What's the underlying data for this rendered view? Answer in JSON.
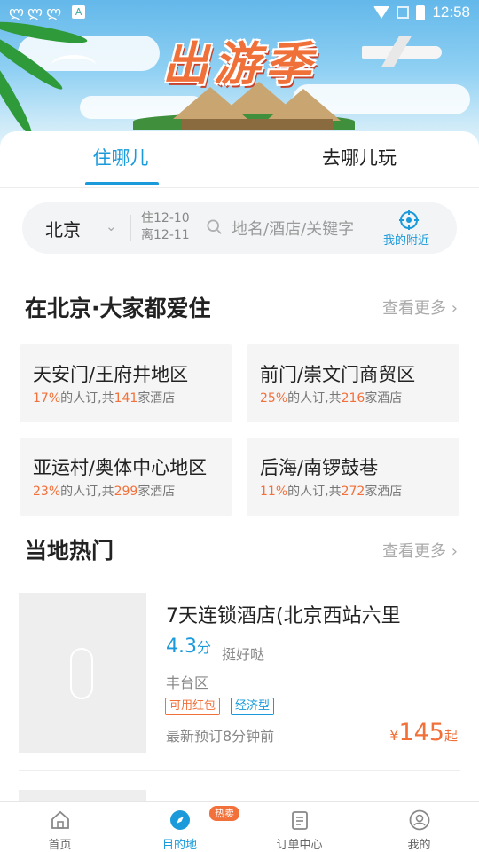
{
  "status_bar": {
    "notification_icons": [
      "bug-icon",
      "bug-icon",
      "bug-icon",
      "a-icon"
    ],
    "notif_glyph": "ლ",
    "a_glyph": "A",
    "time": "12:58"
  },
  "banner": {
    "title": "出游季"
  },
  "tabs": [
    {
      "label": "住哪儿",
      "active": true
    },
    {
      "label": "去哪儿玩",
      "active": false
    }
  ],
  "search": {
    "city": "北京",
    "checkin": "住12-10",
    "checkout": "离12-11",
    "placeholder": "地名/酒店/关键字",
    "nearby_label": "我的附近"
  },
  "popular_areas": {
    "title": "在北京·大家都爱住",
    "more": "查看更多",
    "items": [
      {
        "name": "天安门/王府井地区",
        "percent": "17%",
        "mid": "的人订,共",
        "count": "141",
        "suffix": "家酒店"
      },
      {
        "name": "前门/崇文门商贸区",
        "percent": "25%",
        "mid": "的人订,共",
        "count": "216",
        "suffix": "家酒店"
      },
      {
        "name": "亚运村/奥体中心地区",
        "percent": "23%",
        "mid": "的人订,共",
        "count": "299",
        "suffix": "家酒店"
      },
      {
        "name": "后海/南锣鼓巷",
        "percent": "11%",
        "mid": "的人订,共",
        "count": "272",
        "suffix": "家酒店"
      }
    ]
  },
  "local_hot": {
    "title": "当地热门",
    "more": "查看更多",
    "hotel": {
      "name": "7天连锁酒店(北京西站六里",
      "score": "4.3",
      "score_unit": "分",
      "score_word": "挺好哒",
      "district": "丰台区",
      "tags": [
        "可用红包",
        "经济型"
      ],
      "recent": "最新预订8分钟前",
      "currency": "¥",
      "price": "145",
      "price_suffix": "起"
    }
  },
  "bottom_nav": {
    "items": [
      {
        "label": "首页",
        "icon": "home-icon"
      },
      {
        "label": "目的地",
        "icon": "compass-icon",
        "active": true
      },
      {
        "label": "订单中心",
        "icon": "order-icon"
      },
      {
        "label": "我的",
        "icon": "user-icon"
      }
    ],
    "badge": "热卖"
  },
  "colors": {
    "accent": "#1a9adb",
    "highlight": "#f2703a"
  }
}
